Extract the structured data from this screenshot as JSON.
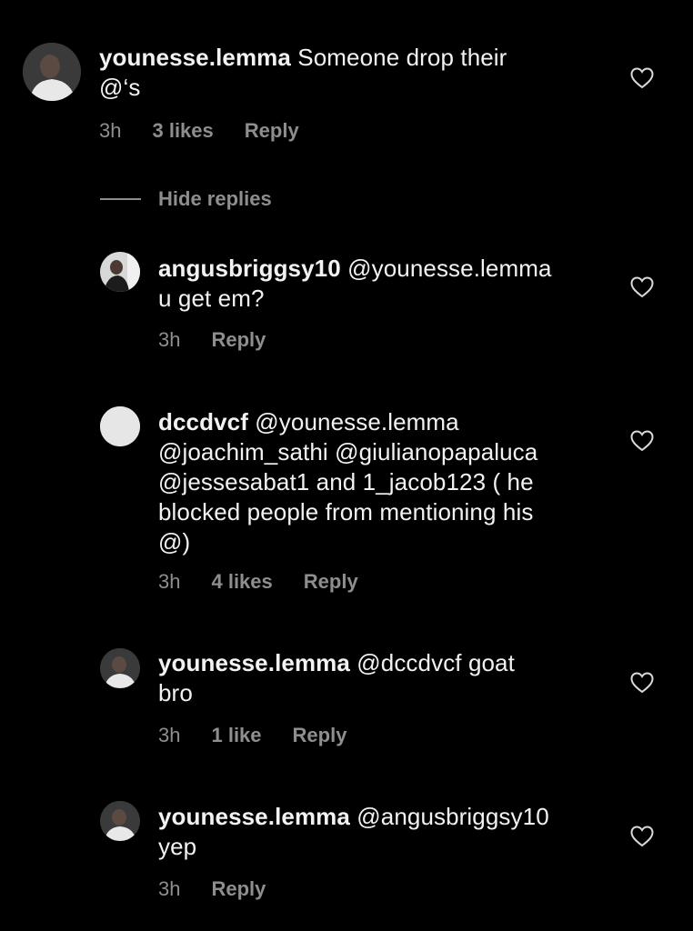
{
  "comments": [
    {
      "username": "younesse.lemma",
      "text": "Someone drop their",
      "text_line2": "@‘s",
      "time": "3h",
      "likes": "3 likes",
      "reply": "Reply",
      "avatar_icon": "profile-photo",
      "like_icon": "heart-outline"
    }
  ],
  "hide_replies": {
    "label": "Hide replies"
  },
  "replies": [
    {
      "username": "angusbriggsy10",
      "mention": "@younesse.lemma",
      "text": "u get em?",
      "time": "3h",
      "reply": "Reply",
      "avatar_icon": "profile-photo"
    },
    {
      "username": "dccdvcf",
      "mention": "@younesse.lemma",
      "line2": "@joachim_sathi @giulianopapaluca",
      "line3": "@jessesabat1 and 1_jacob123 ( he",
      "line4": "blocked people from mentioning his",
      "line5": "@)",
      "time": "3h",
      "likes": "4 likes",
      "reply": "Reply",
      "avatar_icon": "default-avatar"
    },
    {
      "username": "younesse.lemma",
      "mention": "@dccdvcf goat",
      "text": "bro",
      "time": "3h",
      "likes": "1 like",
      "reply": "Reply",
      "avatar_icon": "profile-photo"
    },
    {
      "username": "younesse.lemma",
      "mention": "@angusbriggsy10",
      "text": "yep",
      "time": "3h",
      "reply": "Reply",
      "avatar_icon": "profile-photo"
    }
  ],
  "colors": {
    "background": "#000000",
    "primary_text": "#f2f2f2",
    "secondary_text": "#8e8e8e"
  }
}
